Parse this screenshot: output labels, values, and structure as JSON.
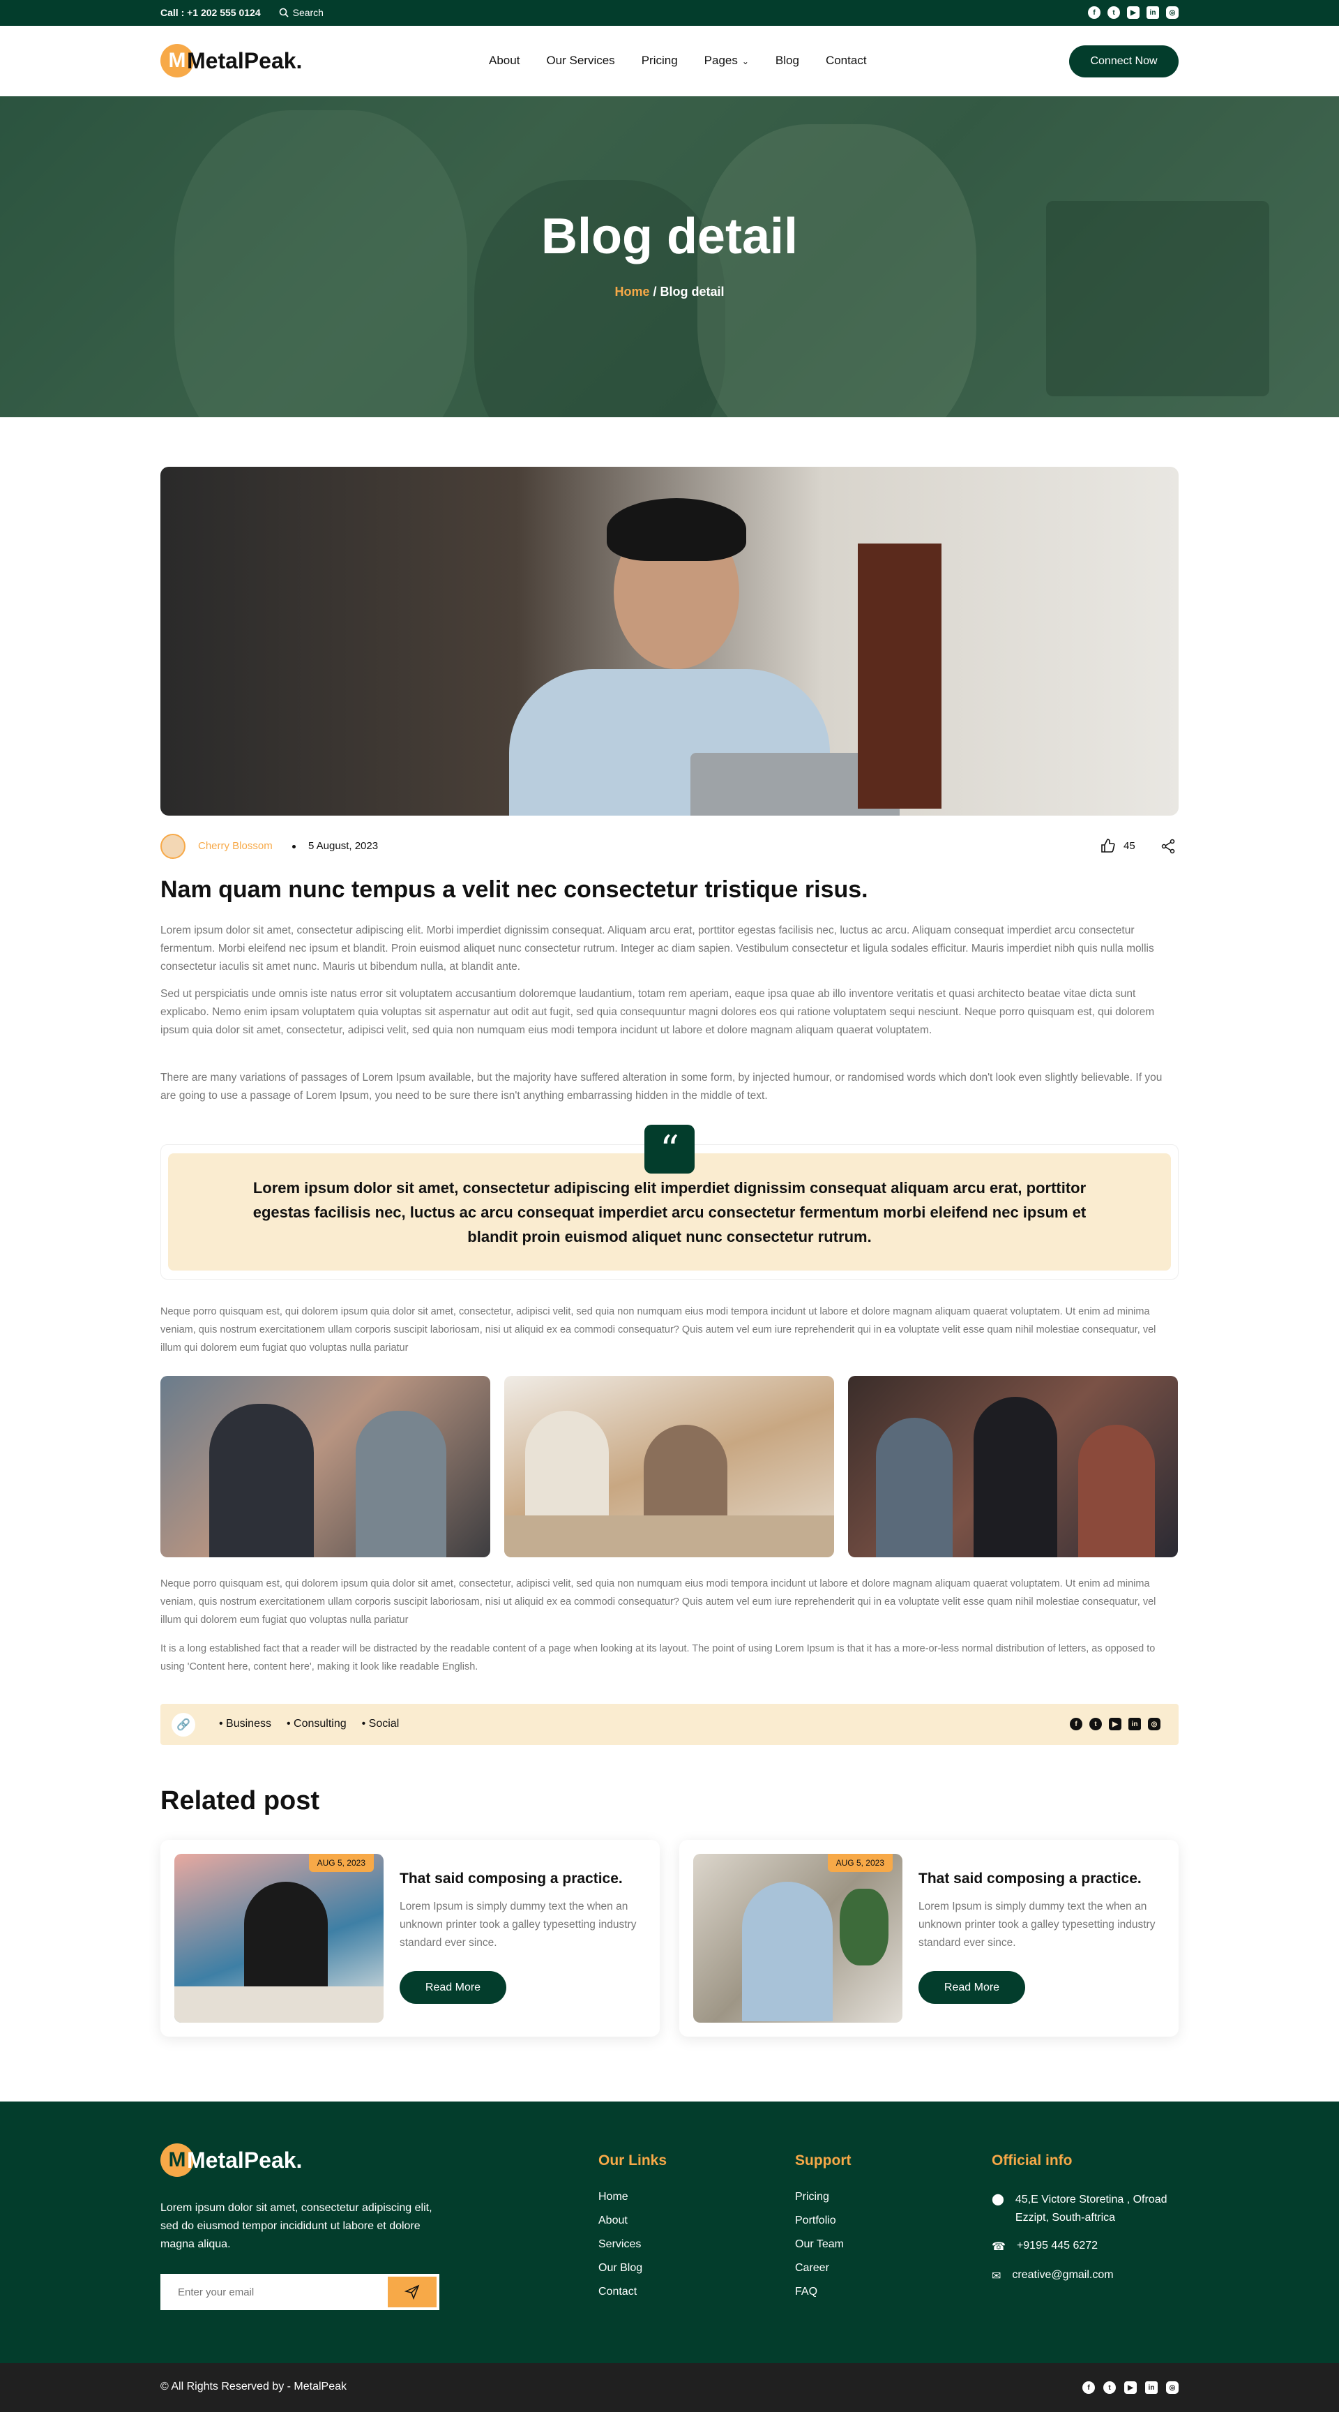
{
  "topbar": {
    "call": "Call : +1 202 555 0124",
    "search": "Search",
    "social_icons": [
      "facebook-icon",
      "twitter-icon",
      "youtube-icon",
      "linkedin-icon",
      "instagram-icon"
    ]
  },
  "brand": {
    "name": "MetalPeak.",
    "initial": "M",
    "accent": "#f7a948",
    "dark": "#033d2c"
  },
  "nav": {
    "items": [
      "About",
      "Our Services",
      "Pricing",
      "Pages",
      "Blog",
      "Contact"
    ],
    "cta": "Connect Now"
  },
  "hero": {
    "title": "Blog detail",
    "breadcrumb_home": "Home",
    "breadcrumb_sep": "/",
    "breadcrumb_current": "Blog detail"
  },
  "post": {
    "author": "Cherry Blossom",
    "date": "5 August, 2023",
    "likes": "45",
    "title": "Nam quam nunc tempus a velit nec consectetur tristique risus.",
    "p1": "Lorem ipsum dolor sit amet, consectetur adipiscing elit. Morbi imperdiet dignissim consequat. Aliquam arcu erat, porttitor egestas facilisis nec, luctus ac arcu. Aliquam consequat imperdiet arcu consectetur fermentum. Morbi eleifend nec ipsum et blandit. Proin euismod aliquet nunc consectetur rutrum. Integer ac diam sapien. Vestibulum consectetur et ligula sodales efficitur. Mauris imperdiet nibh quis nulla mollis consectetur iaculis sit amet nunc. Mauris ut bibendum nulla, at blandit ante.",
    "p2": "Sed ut perspiciatis unde omnis iste natus error sit voluptatem accusantium doloremque laudantium, totam rem aperiam, eaque ipsa quae ab illo inventore veritatis et quasi architecto beatae vitae dicta sunt explicabo. Nemo enim ipsam voluptatem quia voluptas sit aspernatur aut odit aut fugit, sed quia consequuntur magni dolores eos qui ratione voluptatem sequi nesciunt. Neque porro quisquam est, qui dolorem ipsum quia dolor sit amet, consectetur, adipisci velit, sed quia non numquam eius modi tempora incidunt ut labore et dolore magnam aliquam quaerat voluptatem.",
    "p3": "There are many variations of passages of Lorem Ipsum available, but the majority have suffered alteration in some form, by injected humour, or randomised words which don't look even slightly believable. If you are going to use a passage of Lorem Ipsum, you need to be sure there isn't anything embarrassing hidden in the middle of text.",
    "quote": "Lorem ipsum dolor sit amet, consectetur adipiscing elit imperdiet dignissim consequat aliquam arcu erat, porttitor egestas facilisis nec, luctus ac arcu consequat imperdiet arcu consectetur fermentum morbi eleifend nec ipsum et blandit proin euismod aliquet nunc consectetur rutrum.",
    "p4": "Neque porro quisquam est, qui dolorem ipsum quia dolor sit amet, consectetur, adipisci velit, sed quia non numquam eius modi tempora incidunt ut labore et dolore magnam aliquam quaerat voluptatem. Ut enim ad minima veniam, quis nostrum exercitationem ullam corporis suscipit laboriosam, nisi ut aliquid ex ea commodi consequatur? Quis autem vel eum iure reprehenderit qui in ea voluptate velit esse quam nihil molestiae consequatur, vel illum qui dolorem eum fugiat quo voluptas nulla pariatur",
    "p5": "Neque porro quisquam est, qui dolorem ipsum quia dolor sit amet, consectetur, adipisci velit, sed quia non numquam eius modi tempora incidunt ut labore et dolore magnam aliquam quaerat voluptatem. Ut enim ad minima veniam, quis nostrum exercitationem ullam corporis suscipit laboriosam, nisi ut aliquid ex ea commodi consequatur? Quis autem vel eum iure reprehenderit qui in ea voluptate velit esse quam nihil molestiae consequatur, vel illum qui dolorem eum fugiat quo voluptas nulla pariatur",
    "p6": "It is a long established fact that a reader will be distracted by the readable content of a page when looking at its layout. The point of using Lorem Ipsum is that it has a more-or-less normal distribution of letters, as opposed to using 'Content here, content here', making it look like readable English.",
    "tags": [
      "Business",
      "Consulting",
      "Social"
    ]
  },
  "related": {
    "heading": "Related post",
    "cards": [
      {
        "date": "AUG 5, 2023",
        "title": "That said composing a practice.",
        "text": "Lorem Ipsum is simply dummy text the when an unknown printer took a galley typesetting industry standard ever since.",
        "button": "Read More"
      },
      {
        "date": "AUG 5, 2023",
        "title": "That said composing a practice.",
        "text": "Lorem Ipsum is simply dummy text the when an unknown printer took a galley typesetting industry standard ever since.",
        "button": "Read More"
      }
    ]
  },
  "footer": {
    "about": "Lorem ipsum dolor sit amet, consectetur adipiscing elit, sed do eiusmod tempor incididunt ut labore et dolore magna aliqua.",
    "email_placeholder": "Enter your email",
    "links_title": "Our Links",
    "links": [
      "Home",
      "About",
      "Services",
      "Our Blog",
      "Contact"
    ],
    "support_title": "Support",
    "support": [
      "Pricing",
      "Portfolio",
      "Our Team",
      "Career",
      "FAQ"
    ],
    "info_title": "Official info",
    "address_line1": "45,E Victore Storetina , Ofroad",
    "address_line2": "Ezzipt, South-aftrica",
    "phone": "+9195 445 6272",
    "email": "creative@gmail.com",
    "copyright": "© All Rights Reserved by - MetalPeak"
  }
}
